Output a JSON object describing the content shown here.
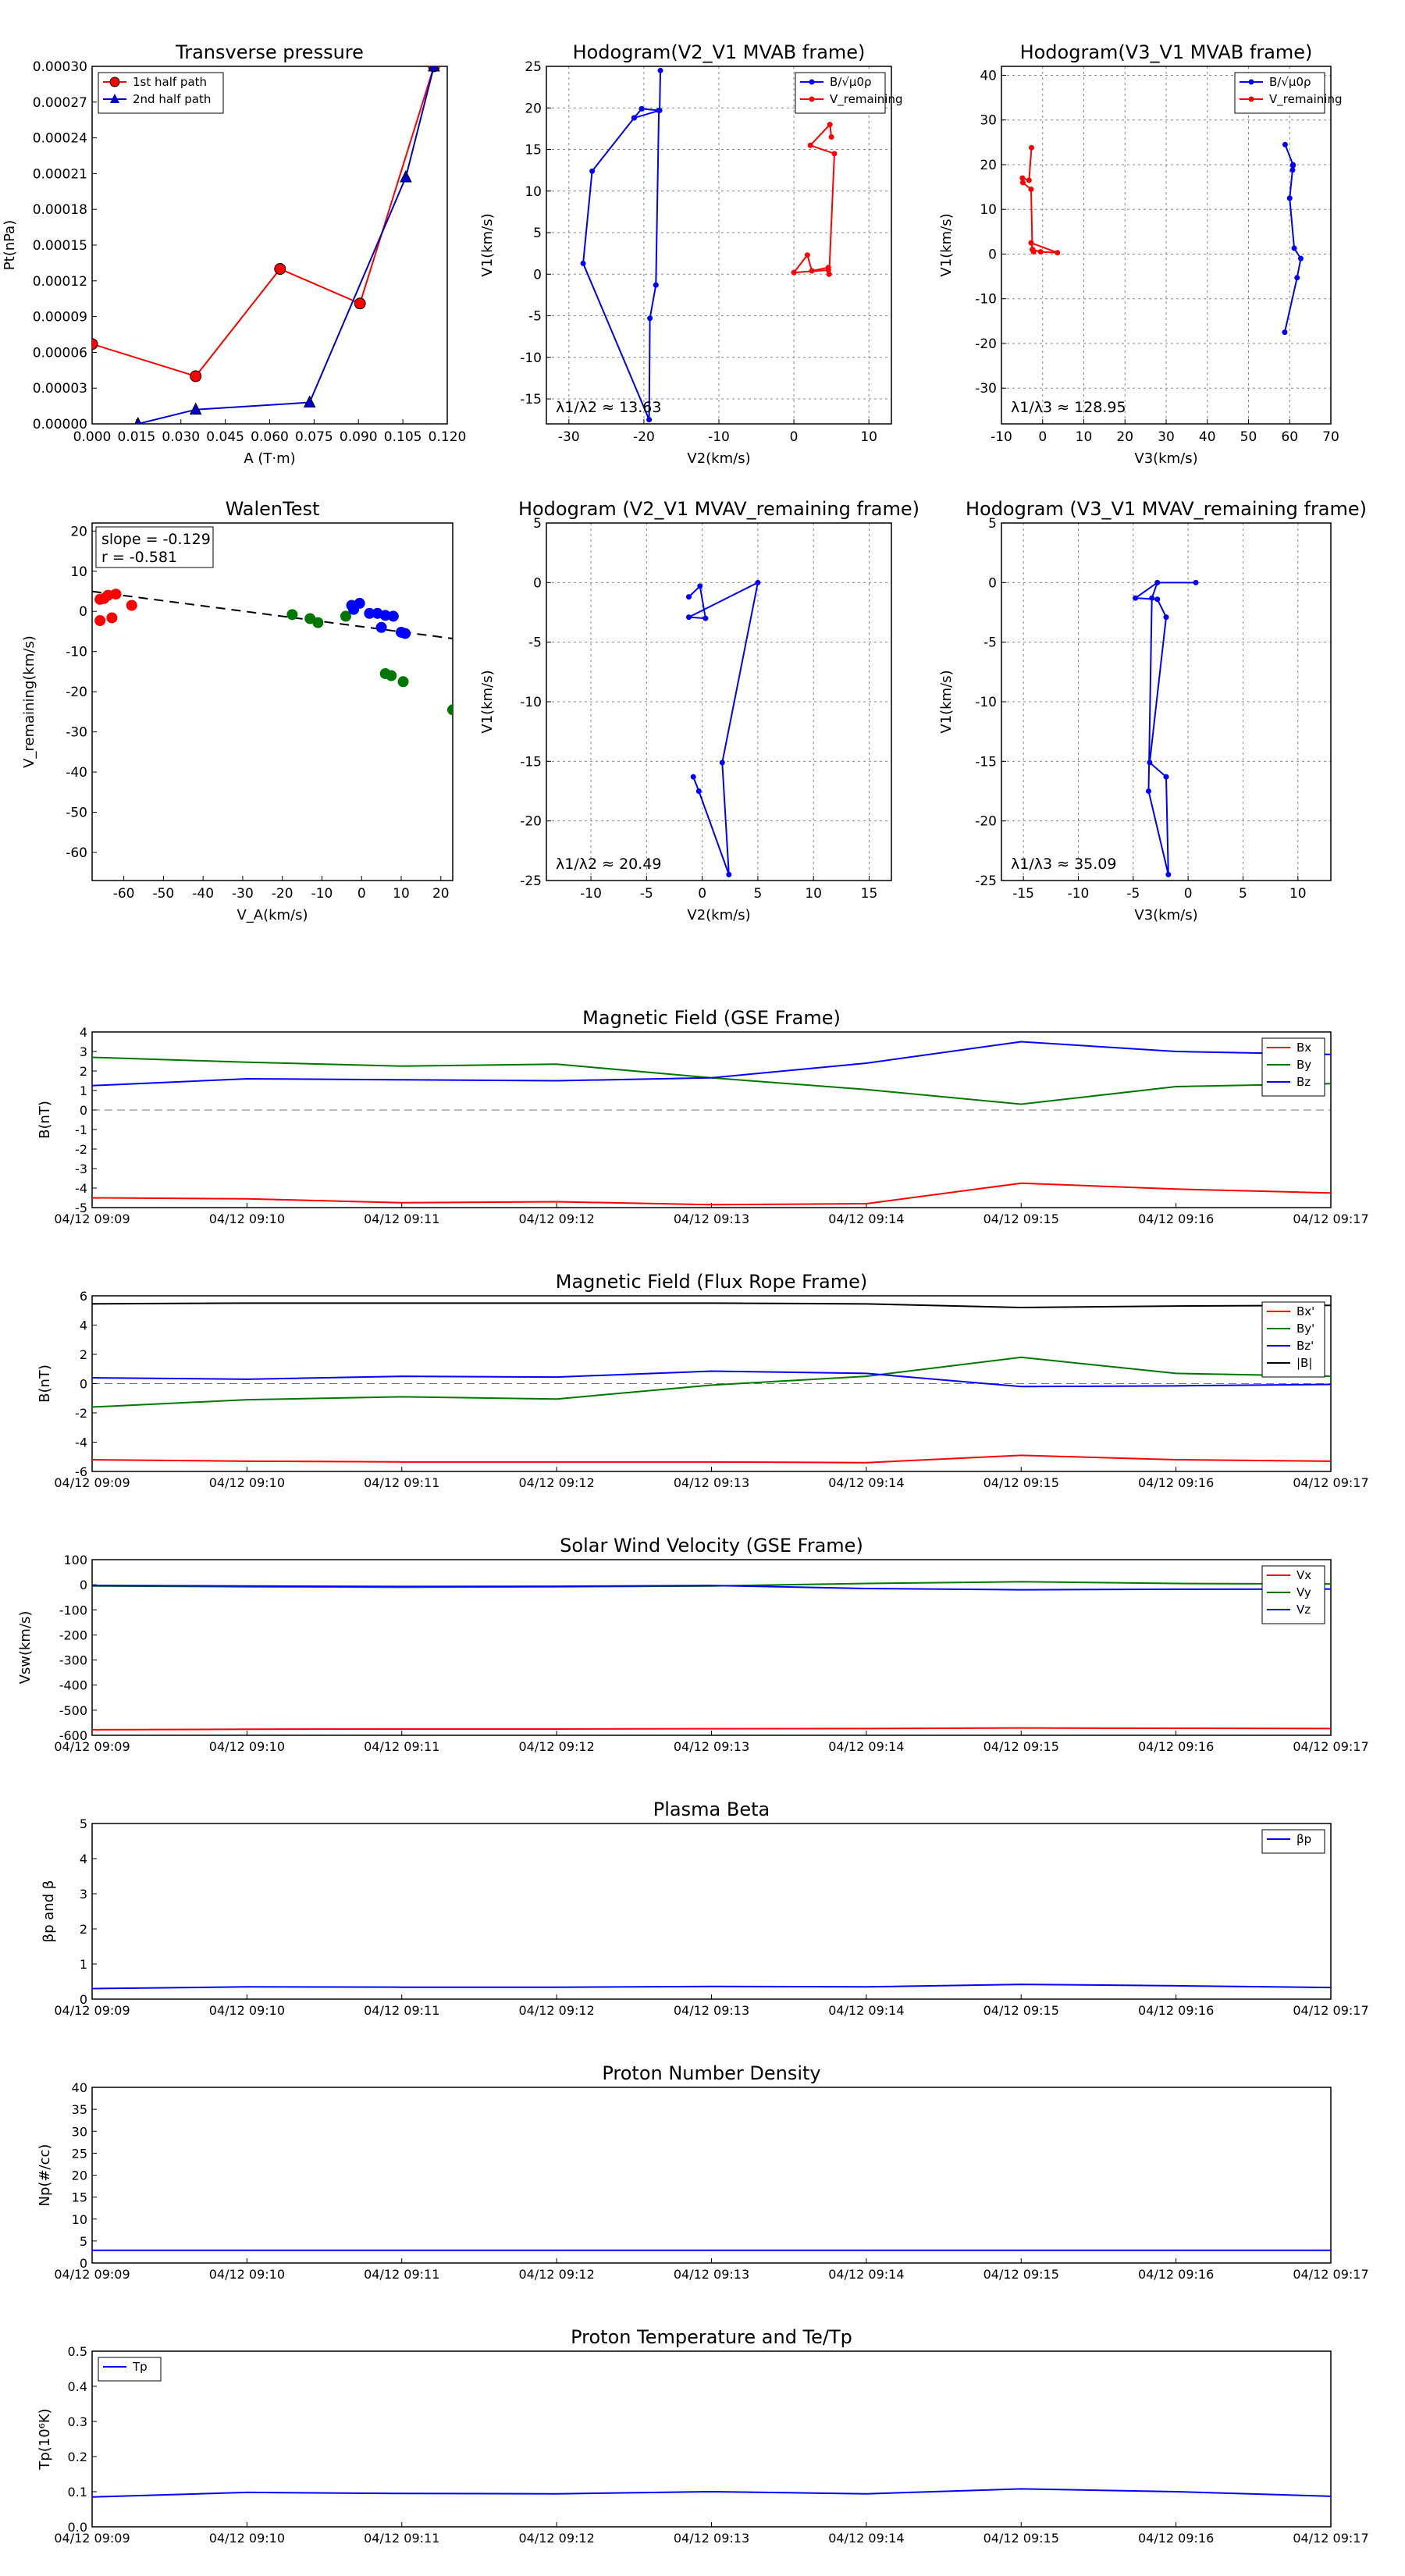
{
  "chart_data": [
    {
      "type": "line",
      "title": "Transverse pressure",
      "xlabel": "A (T·m)",
      "ylabel": "Pt(nPa)",
      "xlim": [
        0,
        0.12
      ],
      "ylim": [
        0,
        0.0003
      ],
      "xticks": [
        "0.000",
        "0.015",
        "0.030",
        "0.045",
        "0.060",
        "0.075",
        "0.090",
        "0.105",
        "0.120"
      ],
      "yticks": [
        "0.00000",
        "0.00003",
        "0.00006",
        "0.00009",
        "0.00012",
        "0.00015",
        "0.00018",
        "0.00021",
        "0.00024",
        "0.00027",
        "0.00030"
      ],
      "legend_position": "top-left",
      "series": [
        {
          "name": "1st half path",
          "color": "#ff0000",
          "marker": "circle",
          "x": [
            0.0,
            0.035,
            0.0635,
            0.0905,
            0.1155
          ],
          "y": [
            6.7e-05,
            4e-05,
            0.00013,
            0.000101,
            0.0003
          ]
        },
        {
          "name": "2nd half path",
          "color": "#0000cc",
          "marker": "triangle",
          "x": [
            0.0155,
            0.035,
            0.0735,
            0.106,
            0.1155
          ],
          "y": [
            0.0,
            1.2e-05,
            1.8e-05,
            0.000207,
            0.0003
          ]
        }
      ]
    },
    {
      "type": "line",
      "title": "Hodogram(V2_V1 MVAB frame)",
      "xlabel": "V2(km/s)",
      "ylabel": "V1(km/s)",
      "xlim": [
        -33,
        13
      ],
      "ylim": [
        -18,
        25
      ],
      "xticks": [
        -30,
        -20,
        -10,
        0,
        10
      ],
      "yticks": [
        -15,
        -10,
        -5,
        0,
        5,
        10,
        15,
        20,
        25
      ],
      "annotation": "λ1/λ2 ≈ 13.63",
      "legend_position": "top-right",
      "series": [
        {
          "name": "B/√μ0ρ",
          "color": "#0000ff",
          "x": [
            -17.8,
            -17.9,
            -21.3,
            -20.3,
            -18.0,
            -18.4,
            -19.2,
            -19.3,
            -28.1,
            -26.9,
            -21.3,
            -20.3
          ],
          "y": [
            24.5,
            19.7,
            18.8,
            19.9,
            19.7,
            -1.3,
            -5.3,
            -17.5,
            1.3,
            12.4,
            18.8,
            19.9
          ]
        },
        {
          "name": "V_remaining",
          "color": "#ff0000",
          "x": [
            5.0,
            4.8,
            2.2,
            5.4,
            4.7,
            4.6,
            2.4,
            1.8,
            0.0,
            4.6
          ],
          "y": [
            16.5,
            18.0,
            15.5,
            14.5,
            0.0,
            0.8,
            0.4,
            2.3,
            0.2,
            0.5
          ]
        }
      ]
    },
    {
      "type": "line",
      "title": "Hodogram(V3_V1 MVAB frame)",
      "xlabel": "V3(km/s)",
      "ylabel": "V1(km/s)",
      "xlim": [
        -10,
        70
      ],
      "ylim": [
        -38,
        42
      ],
      "xticks": [
        -10,
        0,
        10,
        20,
        30,
        40,
        50,
        60,
        70
      ],
      "yticks": [
        -30,
        -20,
        -10,
        0,
        10,
        20,
        30,
        40
      ],
      "annotation": "λ1/λ3 ≈ 128.95",
      "legend_position": "top-right",
      "series": [
        {
          "name": "B/√μ0ρ",
          "color": "#0000ff",
          "x": [
            58.9,
            60.8,
            60.7,
            60.8,
            60.0,
            61.1,
            62.7,
            61.8,
            58.8
          ],
          "y": [
            24.5,
            20.0,
            18.8,
            19.8,
            12.5,
            1.3,
            -1.0,
            -5.3,
            -17.5
          ]
        },
        {
          "name": "V_remaining",
          "color": "#ff0000",
          "x": [
            -2.7,
            -3.3,
            -4.9,
            -4.8,
            -2.8,
            -2.5,
            -2.2,
            -2.8,
            3.6,
            -0.5,
            -2.4
          ],
          "y": [
            23.8,
            16.5,
            17.0,
            16.0,
            14.5,
            1.0,
            0.5,
            2.5,
            0.3,
            0.5,
            1.0
          ]
        }
      ]
    },
    {
      "type": "scatter",
      "title": "WalenTest",
      "xlabel": "V_A(km/s)",
      "ylabel": "V_remaining(km/s)",
      "xlim": [
        -68,
        23
      ],
      "ylim": [
        -67,
        22
      ],
      "xticks": [
        -60,
        -50,
        -40,
        -30,
        -20,
        -10,
        0,
        10,
        20
      ],
      "yticks": [
        -60,
        -50,
        -40,
        -30,
        -20,
        -10,
        0,
        10,
        20
      ],
      "annotation": [
        "slope = -0.129",
        "r = -0.581"
      ],
      "fit_line": {
        "slope": -0.129,
        "intercept": -3.8,
        "style": "dashed"
      },
      "series": [
        {
          "color": "#ff0000",
          "x": [
            -66,
            -65,
            -64,
            -62,
            -58,
            -66,
            -63
          ],
          "y": [
            3,
            3.2,
            4,
            4.3,
            1.5,
            -2.3,
            -1.6
          ]
        },
        {
          "color": "#007700",
          "x": [
            -17.5,
            -13,
            -11,
            -4,
            6,
            7.5,
            10.5,
            23
          ],
          "y": [
            -0.8,
            -1.8,
            -2.8,
            -1.2,
            -15.5,
            -16,
            -17.5,
            -24.5
          ]
        },
        {
          "color": "#0000ff",
          "x": [
            -2.5,
            -2,
            -0.5,
            2,
            4,
            6,
            8,
            10,
            5,
            11
          ],
          "y": [
            1.5,
            0.5,
            2,
            -0.5,
            -0.5,
            -1,
            -1.2,
            -5.2,
            -4,
            -5.5
          ]
        }
      ]
    },
    {
      "type": "line",
      "title": "Hodogram (V2_V1 MVAV_remaining frame)",
      "xlabel": "V2(km/s)",
      "ylabel": "V1(km/s)",
      "xlim": [
        -14,
        17
      ],
      "ylim": [
        -25,
        5
      ],
      "xticks": [
        -10,
        -5,
        0,
        5,
        10,
        15
      ],
      "yticks": [
        -25,
        -20,
        -15,
        -10,
        -5,
        0,
        5
      ],
      "annotation": "λ1/λ2 ≈ 20.49",
      "series": [
        {
          "color": "#0000ff",
          "x": [
            -1.2,
            -0.2,
            0.3,
            -1.2,
            5.0,
            1.8,
            2.4,
            -0.3,
            -0.8
          ],
          "y": [
            -1.2,
            -0.3,
            -3.0,
            -2.9,
            0.0,
            -15.1,
            -24.5,
            -17.5,
            -16.3
          ]
        }
      ]
    },
    {
      "type": "line",
      "title": "Hodogram (V3_V1 MVAV_remaining frame)",
      "xlabel": "V3(km/s)",
      "ylabel": "V1(km/s)",
      "xlim": [
        -17,
        13
      ],
      "ylim": [
        -25,
        5
      ],
      "xticks": [
        -15,
        -10,
        -5,
        0,
        5,
        10
      ],
      "yticks": [
        -25,
        -20,
        -15,
        -10,
        -5,
        0,
        5
      ],
      "annotation": "λ1/λ3 ≈ 35.09",
      "series": [
        {
          "color": "#0000ff",
          "x": [
            0.7,
            -2.8,
            -4.8,
            -2.8,
            -2.0,
            -3.5,
            -2.0,
            -1.8,
            -3.6,
            -3.3,
            -2.8
          ],
          "y": [
            0.0,
            0.0,
            -1.3,
            -1.4,
            -2.9,
            -15.1,
            -16.3,
            -24.5,
            -17.5,
            -1.3,
            0.0
          ]
        }
      ]
    },
    {
      "type": "line",
      "title": "Magnetic Field (GSE Frame)",
      "ylabel": "B(nT)",
      "categories": [
        "04/12 09:09",
        "04/12 09:10",
        "04/12 09:11",
        "04/12 09:12",
        "04/12 09:13",
        "04/12 09:14",
        "04/12 09:15",
        "04/12 09:16",
        "04/12 09:17"
      ],
      "ylim": [
        -5,
        4
      ],
      "yticks": [
        -5,
        -4,
        -3,
        -2,
        -1,
        0,
        1,
        2,
        3,
        4
      ],
      "zero_line": true,
      "legend_position": "top-right",
      "series": [
        {
          "name": "Bx",
          "color": "#ff0000",
          "values": [
            -4.5,
            -4.55,
            -4.75,
            -4.7,
            -4.85,
            -4.8,
            -3.75,
            -4.05,
            -4.25
          ]
        },
        {
          "name": "By",
          "color": "#007700",
          "values": [
            2.7,
            2.45,
            2.25,
            2.35,
            1.65,
            1.05,
            0.3,
            1.2,
            1.35
          ]
        },
        {
          "name": "Bz",
          "color": "#0000ff",
          "values": [
            1.25,
            1.6,
            1.55,
            1.5,
            1.65,
            2.4,
            3.5,
            3.0,
            2.85
          ]
        }
      ]
    },
    {
      "type": "line",
      "title": "Magnetic Field (Flux Rope Frame)",
      "ylabel": "B(nT)",
      "categories": [
        "04/12 09:09",
        "04/12 09:10",
        "04/12 09:11",
        "04/12 09:12",
        "04/12 09:13",
        "04/12 09:14",
        "04/12 09:15",
        "04/12 09:16",
        "04/12 09:17"
      ],
      "ylim": [
        -6,
        6
      ],
      "yticks": [
        -6,
        -4,
        -2,
        0,
        2,
        4,
        6
      ],
      "zero_line": true,
      "legend_position": "top-right",
      "series": [
        {
          "name": "Bx'",
          "color": "#ff0000",
          "values": [
            -5.2,
            -5.3,
            -5.35,
            -5.35,
            -5.35,
            -5.4,
            -4.9,
            -5.2,
            -5.3
          ]
        },
        {
          "name": "By'",
          "color": "#007700",
          "values": [
            -1.6,
            -1.1,
            -0.9,
            -1.05,
            -0.1,
            0.5,
            1.8,
            0.7,
            0.5
          ]
        },
        {
          "name": "Bz'",
          "color": "#0000ff",
          "values": [
            0.4,
            0.3,
            0.5,
            0.45,
            0.85,
            0.7,
            -0.2,
            -0.15,
            -0.05
          ]
        },
        {
          "name": "|B|",
          "color": "#000000",
          "values": [
            5.45,
            5.5,
            5.5,
            5.5,
            5.5,
            5.45,
            5.2,
            5.3,
            5.35
          ]
        }
      ]
    },
    {
      "type": "line",
      "title": "Solar Wind Velocity (GSE Frame)",
      "ylabel": "Vsw(km/s)",
      "categories": [
        "04/12 09:09",
        "04/12 09:10",
        "04/12 09:11",
        "04/12 09:12",
        "04/12 09:13",
        "04/12 09:14",
        "04/12 09:15",
        "04/12 09:16",
        "04/12 09:17"
      ],
      "ylim": [
        -600,
        100
      ],
      "yticks": [
        -600,
        -500,
        -400,
        -300,
        -200,
        -100,
        0,
        100
      ],
      "legend_position": "top-right",
      "series": [
        {
          "name": "Vx",
          "color": "#ff0000",
          "values": [
            -578,
            -576,
            -575,
            -575,
            -574,
            -573,
            -571,
            -572,
            -573
          ]
        },
        {
          "name": "Vy",
          "color": "#007700",
          "values": [
            -5,
            -8,
            -10,
            -8,
            -5,
            5,
            12,
            5,
            3
          ]
        },
        {
          "name": "Vz",
          "color": "#0000ff",
          "values": [
            -3,
            -5,
            -7,
            -6,
            -3,
            -15,
            -20,
            -18,
            -17
          ]
        }
      ]
    },
    {
      "type": "line",
      "title": "Plasma Beta",
      "ylabel": "βp and β",
      "categories": [
        "04/12 09:09",
        "04/12 09:10",
        "04/12 09:11",
        "04/12 09:12",
        "04/12 09:13",
        "04/12 09:14",
        "04/12 09:15",
        "04/12 09:16",
        "04/12 09:17"
      ],
      "ylim": [
        0,
        5
      ],
      "yticks": [
        0,
        1,
        2,
        3,
        4,
        5
      ],
      "legend_position": "top-right",
      "series": [
        {
          "name": "βp",
          "color": "#0000ff",
          "values": [
            0.3,
            0.35,
            0.34,
            0.34,
            0.36,
            0.35,
            0.42,
            0.38,
            0.33
          ]
        }
      ]
    },
    {
      "type": "line",
      "title": "Proton Number Density",
      "ylabel": "Np(#/cc)",
      "categories": [
        "04/12 09:09",
        "04/12 09:10",
        "04/12 09:11",
        "04/12 09:12",
        "04/12 09:13",
        "04/12 09:14",
        "04/12 09:15",
        "04/12 09:16",
        "04/12 09:17"
      ],
      "ylim": [
        0,
        40
      ],
      "yticks": [
        0,
        5,
        10,
        15,
        20,
        25,
        30,
        35,
        40
      ],
      "series": [
        {
          "name": "Np",
          "color": "#0000ff",
          "values": [
            2.9,
            2.9,
            2.9,
            2.9,
            2.9,
            2.9,
            2.9,
            2.9,
            2.9
          ]
        }
      ]
    },
    {
      "type": "line",
      "title": "Proton Temperature and Te/Tp",
      "ylabel": "Tp(10⁶K)",
      "categories": [
        "04/12 09:09",
        "04/12 09:10",
        "04/12 09:11",
        "04/12 09:12",
        "04/12 09:13",
        "04/12 09:14",
        "04/12 09:15",
        "04/12 09:16",
        "04/12 09:17"
      ],
      "ylim": [
        0,
        0.5
      ],
      "yticks": [
        "0.0",
        "0.1",
        "0.2",
        "0.3",
        "0.4",
        "0.5"
      ],
      "legend_position": "top-left",
      "series": [
        {
          "name": "Tp",
          "color": "#0000ff",
          "values": [
            0.085,
            0.098,
            0.095,
            0.094,
            0.1,
            0.094,
            0.108,
            0.1,
            0.087
          ]
        }
      ]
    }
  ]
}
